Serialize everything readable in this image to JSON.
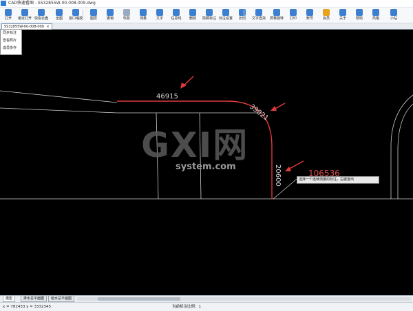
{
  "window": {
    "title": "CAD快速看图 - SS32855W-00-008-009.dwg"
  },
  "toolbar": {
    "items": [
      {
        "label": "打开",
        "icon": "folder-open-icon",
        "color": "#3c7fd1"
      },
      {
        "label": "最近打开",
        "icon": "clock-icon",
        "color": "#3c7fd1"
      },
      {
        "label": "快看云盘",
        "icon": "cloud-icon",
        "color": "#3c7fd1"
      },
      {
        "label": "全图",
        "icon": "fit-all-icon",
        "color": "#3c7fd1"
      },
      {
        "label": "窗口缩放",
        "icon": "window-zoom-icon",
        "color": "#3c7fd1"
      },
      {
        "label": "图层",
        "icon": "layers-icon",
        "color": "#3c7fd1"
      },
      {
        "label": "撤销",
        "icon": "undo-icon",
        "color": "#3c7fd1"
      },
      {
        "label": "恢复",
        "icon": "redo-icon",
        "color": "#9aaac0"
      },
      {
        "label": "测量",
        "icon": "measure-icon",
        "color": "#3c7fd1"
      },
      {
        "label": "文字",
        "icon": "text-icon",
        "color": "#3c7fd1"
      },
      {
        "label": "任意线",
        "icon": "freeline-icon",
        "color": "#3c7fd1"
      },
      {
        "label": "删除",
        "icon": "eraser-icon",
        "color": "#3c7fd1"
      },
      {
        "label": "隐藏标注",
        "icon": "hide-annotation-icon",
        "color": "#3c7fd1"
      },
      {
        "label": "标注设置",
        "icon": "annotation-settings-icon",
        "color": "#3c7fd1"
      },
      {
        "label": "比例",
        "icon": "scale-icon",
        "color": "#3c7fd1"
      },
      {
        "label": "文字查找",
        "icon": "text-search-icon",
        "color": "#3c7fd1"
      },
      {
        "label": "屏幕旋转",
        "icon": "rotate-icon",
        "color": "#3c7fd1"
      },
      {
        "label": "打印",
        "icon": "printer-icon",
        "color": "#3c7fd1"
      },
      {
        "label": "账号",
        "icon": "user-icon",
        "color": "#3c7fd1"
      },
      {
        "label": "会员",
        "icon": "vip-icon",
        "color": "#e8a21c"
      },
      {
        "label": "关于",
        "icon": "info-icon",
        "color": "#3c7fd1"
      },
      {
        "label": "帮助",
        "icon": "help-icon",
        "color": "#3c7fd1"
      },
      {
        "label": "风格",
        "icon": "theme-icon",
        "color": "#3c7fd1"
      },
      {
        "label": "小站",
        "icon": "k-logo-icon",
        "color": "#3c7fd1"
      }
    ]
  },
  "document_tab": {
    "label": "SS32855W-00-008-009"
  },
  "context_menu": {
    "items": [
      "同步标注",
      "查看照片",
      "成员协作"
    ]
  },
  "canvas": {
    "dimensions": [
      "46915",
      "39021",
      "20600",
      "106536"
    ],
    "tooltip": "选择一个连续测量的标注，右键退出",
    "colors": {
      "curve": "#e23a3a",
      "lines": "#cfcfcf",
      "arrow": "#e23a3a",
      "total": "#e05050"
    }
  },
  "watermark": {
    "logo": "GXI网",
    "site": "system.com"
  },
  "sheets": {
    "tabs": [
      "模型",
      "排水总平面图",
      "给水总平面图"
    ]
  },
  "status": {
    "coords": "x = 782433  y = 3332345",
    "scale": "当前标注比例：1"
  }
}
